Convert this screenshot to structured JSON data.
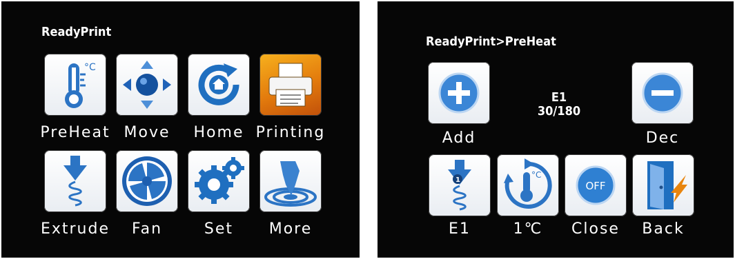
{
  "main_screen": {
    "title": "ReadyPrint",
    "buttons": [
      {
        "label": "PreHeat",
        "icon": "thermometer-icon"
      },
      {
        "label": "Move",
        "icon": "move-arrows-icon"
      },
      {
        "label": "Home",
        "icon": "home-refresh-icon"
      },
      {
        "label": "Printing",
        "icon": "printer-icon"
      },
      {
        "label": "Extrude",
        "icon": "extruder-icon"
      },
      {
        "label": "Fan",
        "icon": "fan-icon"
      },
      {
        "label": "Set",
        "icon": "gears-icon"
      },
      {
        "label": "More",
        "icon": "touch-more-icon"
      }
    ]
  },
  "preheat_screen": {
    "title": "ReadyPrint>PreHeat",
    "status_line1": "E1",
    "status_line2": "30/180",
    "buttons": [
      {
        "label": "Add",
        "icon": "plus-icon"
      },
      {
        "label": "Dec",
        "icon": "minus-icon"
      },
      {
        "label": "E1",
        "icon": "extruder-1-icon"
      },
      {
        "label": "1℃",
        "icon": "thermometer-cycle-icon"
      },
      {
        "label": "Close",
        "icon": "off-icon"
      },
      {
        "label": "Back",
        "icon": "exit-door-icon"
      }
    ]
  },
  "colors": {
    "screen_bg": "#060606",
    "tile_bg": "#f3f5f8",
    "icon_blue": "#1f6fc0",
    "accent_orange": "#e8850f"
  }
}
